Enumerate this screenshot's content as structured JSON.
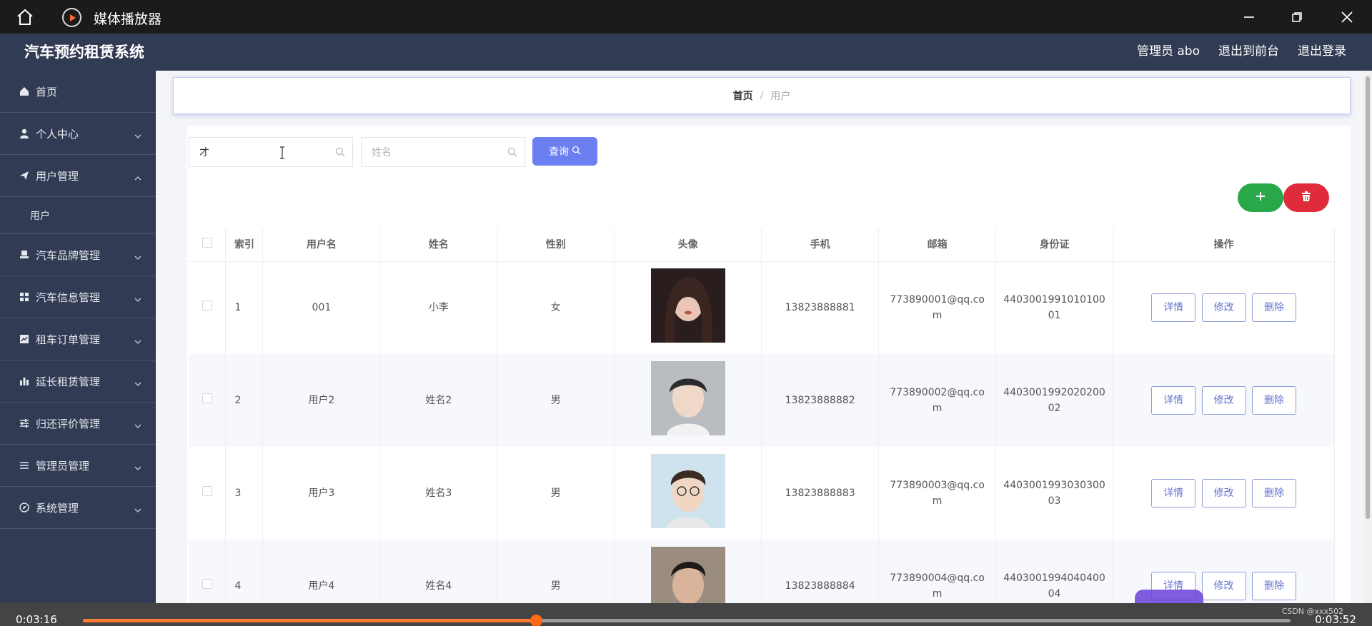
{
  "player": {
    "title": "媒体播放器",
    "time_current": "0:03:16",
    "time_total": "0:03:52",
    "progress_fraction": 0.375,
    "watermark": "CSDN @xxx502"
  },
  "header": {
    "app_title": "汽车预约租赁系统",
    "admin_label": "管理员 abo",
    "to_front_label": "退出到前台",
    "logout_label": "退出登录"
  },
  "sidebar": {
    "items": [
      {
        "label": "首页",
        "icon": "home-icon"
      },
      {
        "label": "个人中心",
        "icon": "user-icon"
      },
      {
        "label": "用户管理",
        "icon": "send-icon"
      },
      {
        "label": "用户",
        "icon": ""
      },
      {
        "label": "汽车品牌管理",
        "icon": "stamp-icon"
      },
      {
        "label": "汽车信息管理",
        "icon": "grid-icon"
      },
      {
        "label": "租车订单管理",
        "icon": "chart-icon"
      },
      {
        "label": "延长租赁管理",
        "icon": "bar-chart-icon"
      },
      {
        "label": "归还评价管理",
        "icon": "sliders-icon"
      },
      {
        "label": "管理员管理",
        "icon": "list-icon"
      },
      {
        "label": "系统管理",
        "icon": "compass-icon"
      }
    ]
  },
  "breadcrumb": {
    "home": "首页",
    "sep": "/",
    "current": "用户"
  },
  "search": {
    "username_value": "才",
    "name_placeholder": "姓名",
    "query_label": "查询"
  },
  "table": {
    "headers": [
      "索引",
      "用户名",
      "姓名",
      "性别",
      "头像",
      "手机",
      "邮箱",
      "身份证",
      "操作"
    ],
    "rows": [
      {
        "index": "1",
        "username": "001",
        "name": "小李",
        "gender": "女",
        "phone": "13823888881",
        "email_1": "773890001@qq.co",
        "email_2": "m",
        "id_1": "4403001991010100",
        "id_2": "01"
      },
      {
        "index": "2",
        "username": "用户2",
        "name": "姓名2",
        "gender": "男",
        "phone": "13823888882",
        "email_1": "773890002@qq.co",
        "email_2": "m",
        "id_1": "4403001992020200",
        "id_2": "02"
      },
      {
        "index": "3",
        "username": "用户3",
        "name": "姓名3",
        "gender": "男",
        "phone": "13823888883",
        "email_1": "773890003@qq.co",
        "email_2": "m",
        "id_1": "4403001993030300",
        "id_2": "03"
      },
      {
        "index": "4",
        "username": "用户4",
        "name": "姓名4",
        "gender": "男",
        "phone": "13823888884",
        "email_1": "773890004@qq.co",
        "email_2": "m",
        "id_1": "4403001994040400",
        "id_2": "04"
      }
    ],
    "actions": {
      "detail": "详情",
      "edit": "修改",
      "delete": "删除"
    }
  },
  "colors": {
    "sidebar_bg": "#323b54",
    "accent": "#6b7ff0",
    "add_green": "#29a84a",
    "delete_red": "#e02b3a",
    "progress_orange": "#ff7a2f"
  }
}
